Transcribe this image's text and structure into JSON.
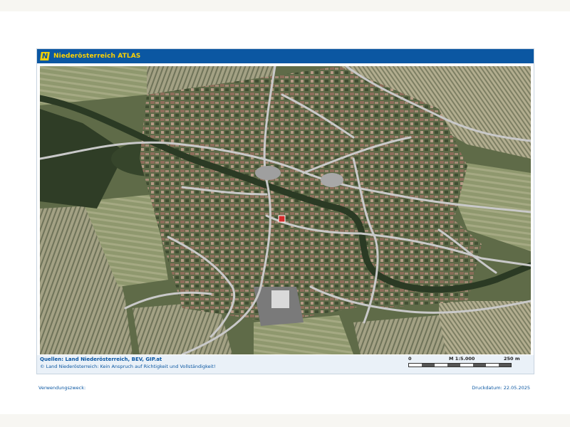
{
  "header": {
    "logo_glyph": "N",
    "title": "Niederösterreich ATLAS"
  },
  "map": {
    "view": "aerial-orthophoto",
    "marker_color": "#d62c2c",
    "road_color": "#c9c9c9"
  },
  "footer": {
    "sources": "Quellen: Land Niederösterreich, BEV, GIP.at",
    "copyright": "© Land Niederösterreich: Kein Anspruch auf Richtigkeit und Vollständigkeit!",
    "scale_zero": "0",
    "scale_ratio": "M 1:5.000",
    "scale_end": "250 m"
  },
  "purpose_label": "Verwendungszweck:",
  "print_date": "Druckdatum: 22.05.2025",
  "colors": {
    "header_bg": "#0b57a2",
    "title_color": "#ffd200",
    "footer_bg": "#eaf1f8"
  }
}
